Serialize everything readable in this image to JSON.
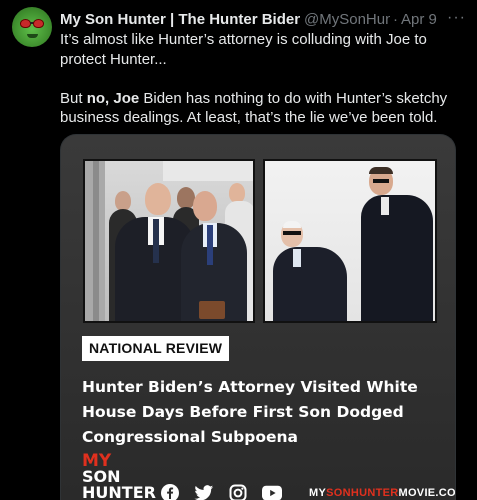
{
  "author": {
    "display_name": "My Son Hunter | The Hunter Biden I",
    "handle": "@MySonHun",
    "separator": "·",
    "date": "Apr 9",
    "more_label": "···"
  },
  "tweet": {
    "line1": "It’s almost like Hunter’s attorney is colluding with Joe to protect Hunter...",
    "line2_prefix": "But ",
    "line2_bold": "no, Joe",
    "line2_rest": " Biden has nothing to do with Hunter’s sketchy business dealings. At least, that’s the lie we’ve been told."
  },
  "card": {
    "source_badge": "NATIONAL REVIEW",
    "headline": "Hunter Biden’s Attorney Visited White House Days Before First Son Dodged Congressional Subpoena",
    "logo_my": "MY",
    "logo_son": "SON",
    "logo_hunter": "HUNTER",
    "site_prefix": "MY",
    "site_highlight": "SONHUNTER",
    "site_suffix": "MOVIE.COM",
    "social_icons": [
      "facebook-icon",
      "twitter-icon",
      "instagram-icon",
      "youtube-icon"
    ]
  },
  "colors": {
    "background": "#000000",
    "text": "#e7e9ea",
    "muted": "#71767b",
    "brand_red": "#e0301e"
  }
}
